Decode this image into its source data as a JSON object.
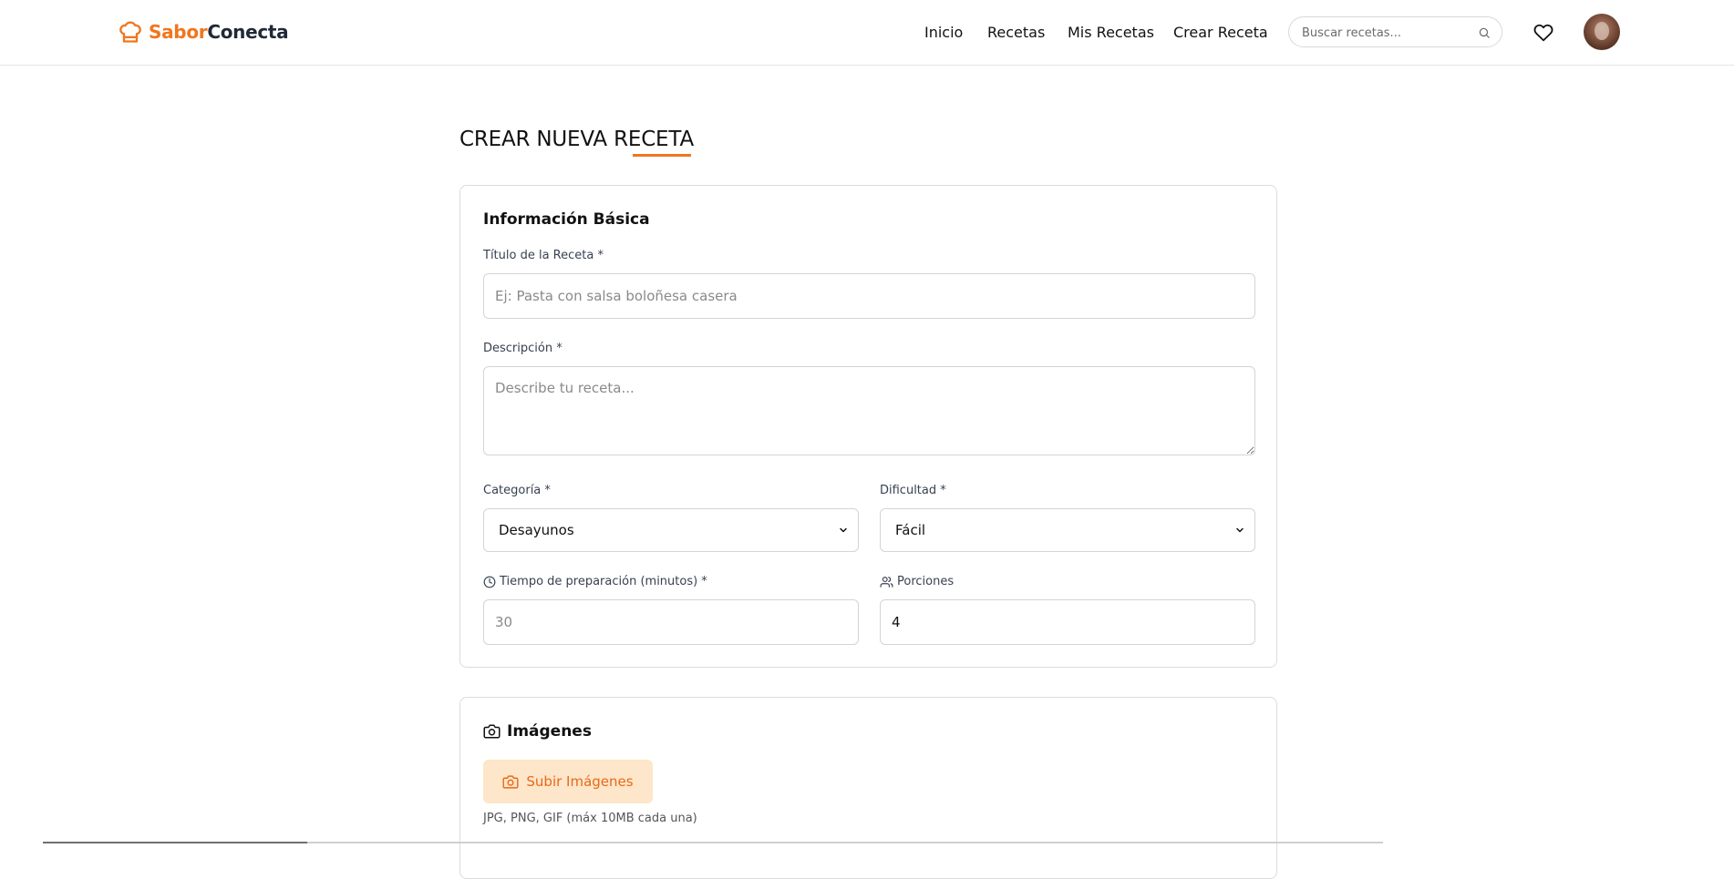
{
  "app": {
    "brand_part1": "Sabor",
    "brand_part2": "Conecta"
  },
  "nav": {
    "items": [
      "Inicio",
      "Recetas",
      "Mis Recetas",
      "Crear Receta"
    ]
  },
  "search": {
    "placeholder": "Buscar recetas..."
  },
  "page": {
    "title": "CREAR NUEVA RECETA"
  },
  "basic_info": {
    "title": "Información Básica",
    "recipe_title_label": "Título de la Receta *",
    "recipe_title_placeholder": "Ej: Pasta con salsa boloñesa casera",
    "description_label": "Descripción *",
    "description_placeholder": "Describe tu receta...",
    "category_label": "Categoría *",
    "category_value": "Desayunos",
    "difficulty_label": "Dificultad *",
    "difficulty_value": "Fácil",
    "prep_time_label": "Tiempo de preparación (minutos) *",
    "prep_time_placeholder": "30",
    "servings_label": "Porciones",
    "servings_value": "4"
  },
  "images": {
    "title": "Imágenes",
    "upload_label": "Subir Imágenes",
    "hint": "JPG, PNG, GIF (máx 10MB cada una)"
  },
  "colors": {
    "accent": "#f0761e",
    "upload_bg": "#fde6c9"
  },
  "icons": [
    "chef-hat-icon",
    "search-icon",
    "heart-icon",
    "clock-icon",
    "users-icon",
    "camera-icon",
    "chevron-down-icon"
  ]
}
